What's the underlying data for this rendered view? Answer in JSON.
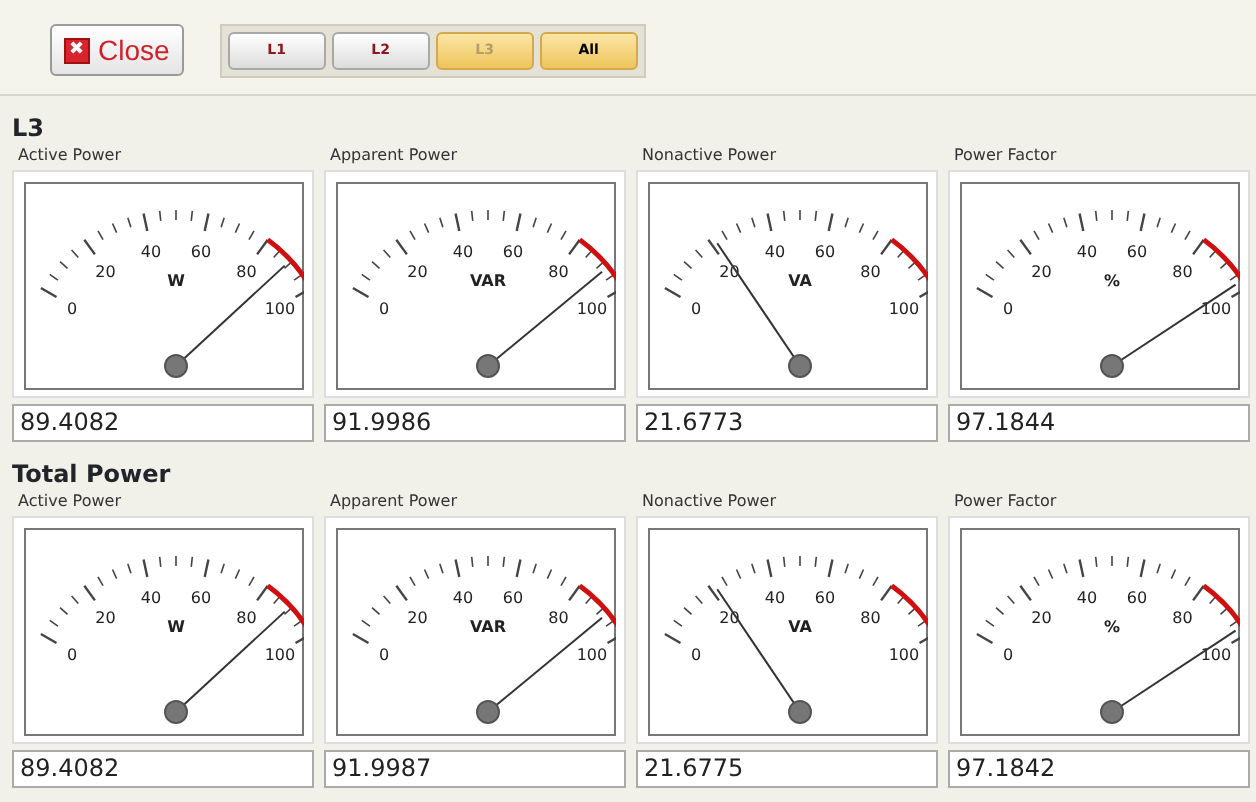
{
  "toolbar": {
    "close_button": {
      "icon": "✖",
      "label": "Close"
    },
    "phase_buttons": [
      {
        "label": "L1",
        "highlighted": false,
        "disabled": false
      },
      {
        "label": "L2",
        "highlighted": false,
        "disabled": false
      },
      {
        "label": "L3",
        "highlighted": true,
        "disabled": true
      },
      {
        "label": "All",
        "highlighted": true,
        "disabled": false
      }
    ]
  },
  "sections": [
    {
      "title": "L3",
      "gauges": [
        {
          "label": "Active Power",
          "scale": [
            "0",
            "20",
            "40",
            "60",
            "80",
            "100"
          ],
          "unit": "W",
          "value": "89.4082"
        },
        {
          "label": "Apparent Power",
          "scale": [
            "0",
            "20",
            "40",
            "60",
            "80",
            "100"
          ],
          "unit": "VAR",
          "value": "91.9986"
        },
        {
          "label": "Nonactive Power",
          "scale": [
            "0",
            "20",
            "40",
            "60",
            "80",
            "100"
          ],
          "unit": "VA",
          "value": "21.6773"
        },
        {
          "label": "Power Factor",
          "scale": [
            "0",
            "20",
            "40",
            "60",
            "80",
            "100"
          ],
          "unit": "%",
          "value": "97.1844"
        }
      ]
    },
    {
      "title": "Total Power",
      "gauges": [
        {
          "label": "Active Power",
          "scale": [
            "0",
            "20",
            "40",
            "60",
            "80",
            "100"
          ],
          "unit": "W",
          "value": "89.4082"
        },
        {
          "label": "Apparent Power",
          "scale": [
            "0",
            "20",
            "40",
            "60",
            "80",
            "100"
          ],
          "unit": "VAR",
          "value": "91.9987"
        },
        {
          "label": "Nonactive Power",
          "scale": [
            "0",
            "20",
            "40",
            "60",
            "80",
            "100"
          ],
          "unit": "VA",
          "value": "21.6775"
        },
        {
          "label": "Power Factor",
          "scale": [
            "0",
            "20",
            "40",
            "60",
            "80",
            "100"
          ],
          "unit": "%",
          "value": "97.1842"
        }
      ]
    }
  ]
}
